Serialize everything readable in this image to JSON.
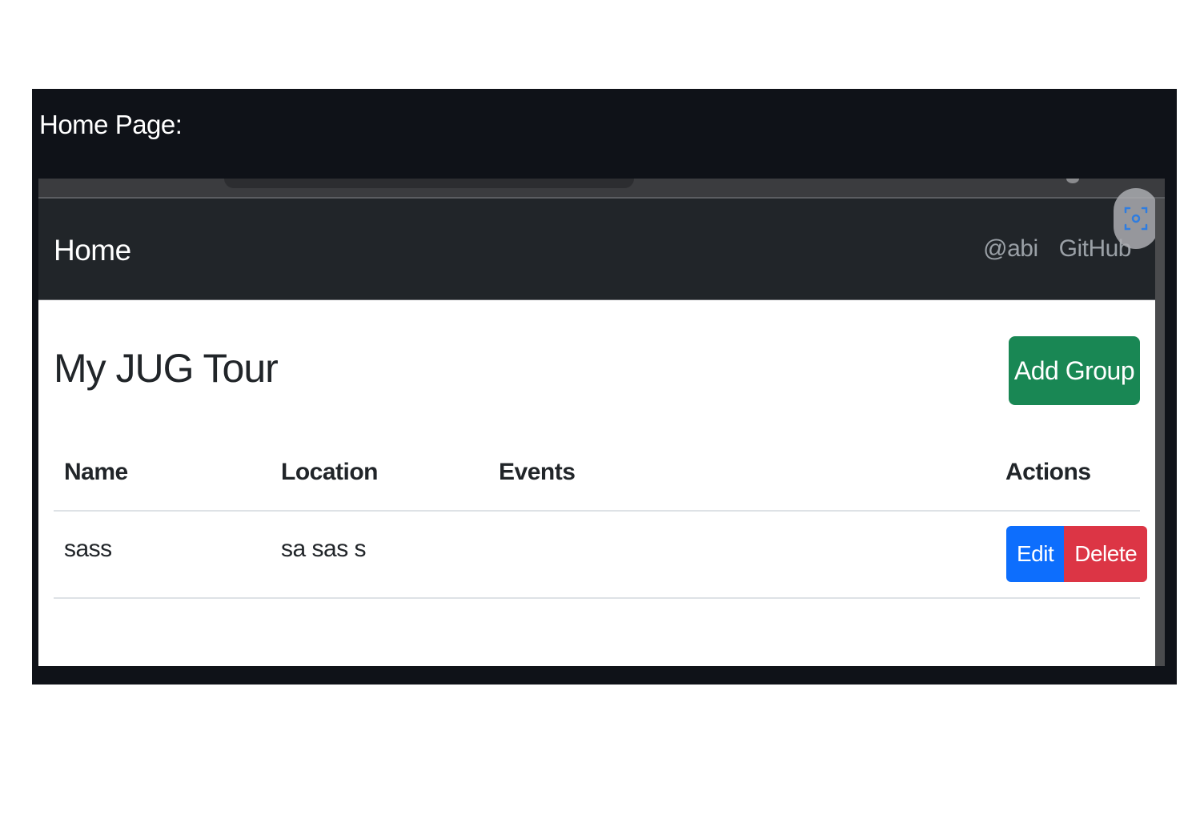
{
  "caption": "Home Page:",
  "navbar": {
    "brand": "Home",
    "links": [
      "@abi",
      "GitHub"
    ]
  },
  "page": {
    "title": "My JUG Tour",
    "add_button": "Add Group"
  },
  "table": {
    "headers": [
      "Name",
      "Location",
      "Events",
      "Actions"
    ],
    "rows": [
      {
        "name": "sass",
        "location": "sa sas s",
        "events": "",
        "actions": [
          "Edit",
          "Delete"
        ]
      }
    ]
  },
  "colors": {
    "navbar_bg": "#212529",
    "success": "#198754",
    "primary": "#0d6efd",
    "danger": "#dc3545"
  },
  "icons": {
    "overlay": "screenshot-scan-icon"
  }
}
